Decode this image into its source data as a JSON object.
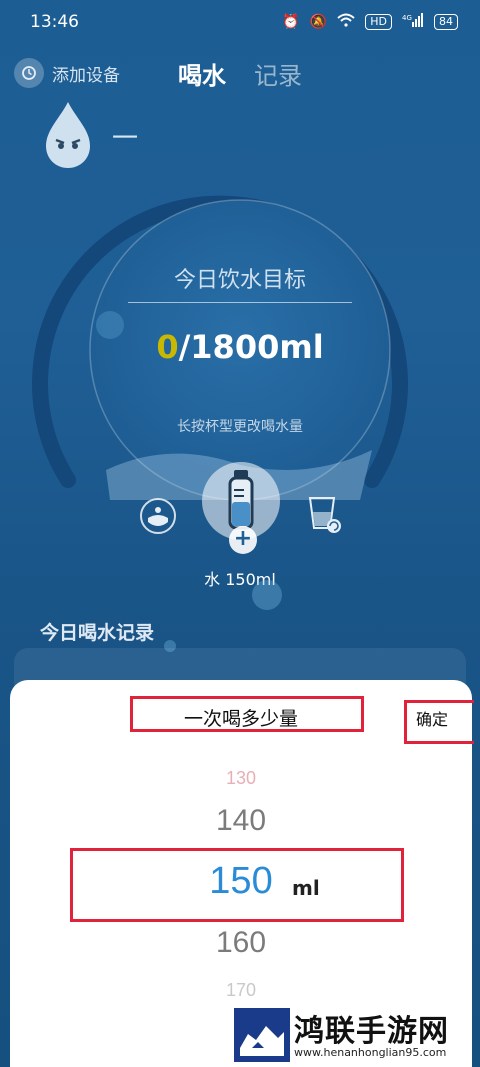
{
  "status": {
    "time": "13:46",
    "battery": "84",
    "signal": "4G",
    "hd": "HD"
  },
  "nav": {
    "add_device": "添加设备",
    "tab_drink": "喝水",
    "tab_record": "记录"
  },
  "profile": {
    "name_placeholder": "一"
  },
  "goal": {
    "title": "今日饮水目标",
    "current": "0",
    "total": "/1800ml",
    "hint": "长按杯型更改喝水量"
  },
  "cup": {
    "label": "水 150ml"
  },
  "records": {
    "title": "今日喝水记录"
  },
  "sheet": {
    "title": "一次喝多少量",
    "confirm": "确定",
    "options": [
      "130",
      "140",
      "150",
      "160",
      "170"
    ],
    "selected": "150",
    "unit": "ml"
  },
  "watermark": {
    "title": "鸿联手游网",
    "url": "www.henanhonglian95.com"
  },
  "colors": {
    "accent_blue": "#2a8bd6",
    "highlight_red": "#e0223a",
    "current_value": "#c9b800"
  }
}
